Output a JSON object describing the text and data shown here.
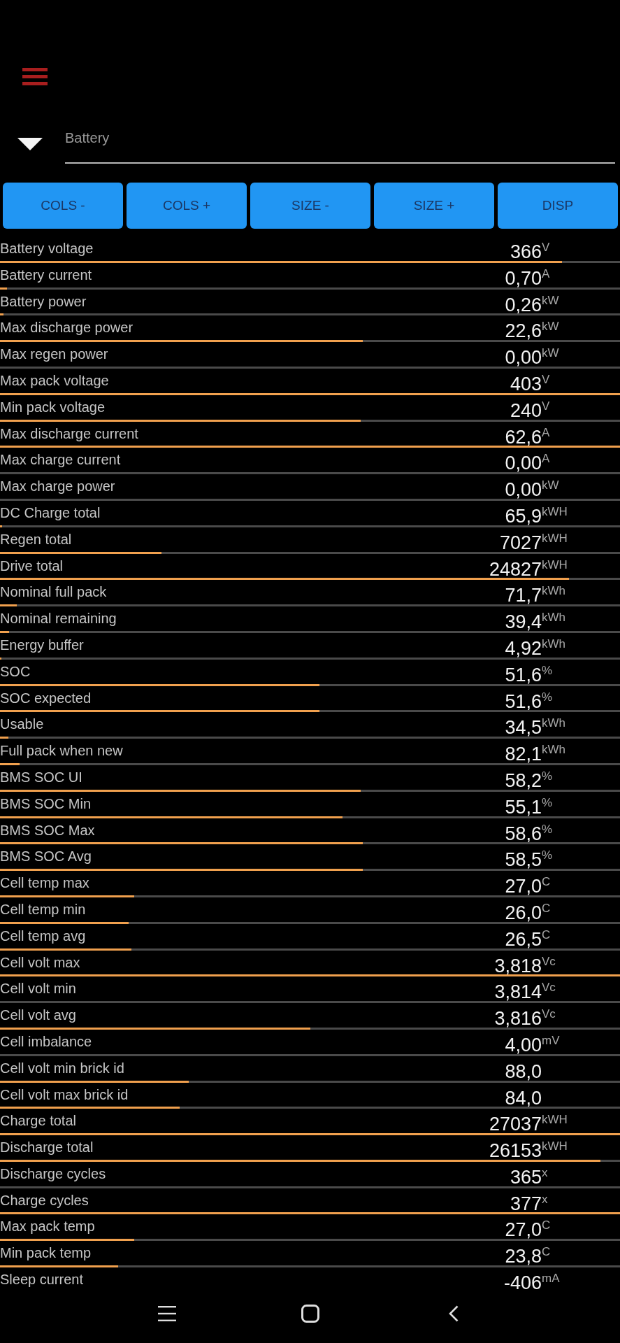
{
  "selector": {
    "value": "Battery"
  },
  "buttons": [
    "COLS -",
    "COLS +",
    "SIZE -",
    "SIZE +",
    "DISP"
  ],
  "readings": [
    {
      "name": "Battery voltage",
      "value": "366",
      "unit": "V",
      "level": 0.906
    },
    {
      "name": "Battery current",
      "value": "0,70",
      "unit": "A",
      "level": 0.011
    },
    {
      "name": "Battery power",
      "value": "0,26",
      "unit": "kW",
      "level": 0.006
    },
    {
      "name": "Max discharge power",
      "value": "22,6",
      "unit": "kW",
      "level": 0.585
    },
    {
      "name": "Max regen power",
      "value": "0,00",
      "unit": "kW",
      "level": 0
    },
    {
      "name": "Max pack voltage",
      "value": "403",
      "unit": "V",
      "level": 1
    },
    {
      "name": "Min pack voltage",
      "value": "240",
      "unit": "V",
      "level": 0.582
    },
    {
      "name": "Max discharge current",
      "value": "62,6",
      "unit": "A",
      "level": 1
    },
    {
      "name": "Max charge current",
      "value": "0,00",
      "unit": "A",
      "level": 0
    },
    {
      "name": "Max charge power",
      "value": "0,00",
      "unit": "kW",
      "level": 0
    },
    {
      "name": "DC Charge total",
      "value": "65,9",
      "unit": "kWH",
      "level": 0.003
    },
    {
      "name": "Regen total",
      "value": "7027",
      "unit": "kWH",
      "level": 0.26
    },
    {
      "name": "Drive total",
      "value": "24827",
      "unit": "kWH",
      "level": 0.918
    },
    {
      "name": "Nominal full pack",
      "value": "71,7",
      "unit": "kWh",
      "level": 0.027
    },
    {
      "name": "Nominal remaining",
      "value": "39,4",
      "unit": "kWh",
      "level": 0.015
    },
    {
      "name": "Energy buffer",
      "value": "4,92",
      "unit": "kWh",
      "level": 0.002
    },
    {
      "name": "SOC",
      "value": "51,6",
      "unit": "%",
      "level": 0.515
    },
    {
      "name": "SOC expected",
      "value": "51,6",
      "unit": "%",
      "level": 0.515
    },
    {
      "name": "Usable",
      "value": "34,5",
      "unit": "kWh",
      "level": 0.013
    },
    {
      "name": "Full pack when new",
      "value": "82,1",
      "unit": "kWh",
      "level": 0.032
    },
    {
      "name": "BMS SOC UI",
      "value": "58,2",
      "unit": "%",
      "level": 0.582
    },
    {
      "name": "BMS SOC Min",
      "value": "55,1",
      "unit": "%",
      "level": 0.552
    },
    {
      "name": "BMS SOC Max",
      "value": "58,6",
      "unit": "%",
      "level": 0.585
    },
    {
      "name": "BMS SOC Avg",
      "value": "58,5",
      "unit": "%",
      "level": 0.585
    },
    {
      "name": "Cell temp max",
      "value": "27,0",
      "unit": "C",
      "level": 0.217
    },
    {
      "name": "Cell temp min",
      "value": "26,0",
      "unit": "C",
      "level": 0.208
    },
    {
      "name": "Cell temp avg",
      "value": "26,5",
      "unit": "C",
      "level": 0.212
    },
    {
      "name": "Cell volt max",
      "value": "3,818",
      "unit": "Vc",
      "level": 1
    },
    {
      "name": "Cell volt min",
      "value": "3,814",
      "unit": "Vc",
      "level": 0
    },
    {
      "name": "Cell volt avg",
      "value": "3,816",
      "unit": "Vc",
      "level": 0.5
    },
    {
      "name": "Cell imbalance",
      "value": "4,00",
      "unit": "mV",
      "level": 0
    },
    {
      "name": "Cell volt min brick id",
      "value": "88,0",
      "level": 0.304
    },
    {
      "name": "Cell volt max brick id",
      "value": "84,0",
      "level": 0.29
    },
    {
      "name": "Charge total",
      "value": "27037",
      "unit": "kWH",
      "level": 1
    },
    {
      "name": "Discharge total",
      "value": "26153",
      "unit": "kWH",
      "level": 0.968
    },
    {
      "name": "Discharge cycles",
      "value": "365",
      "unit": "x",
      "level": 0
    },
    {
      "name": "Charge cycles",
      "value": "377",
      "unit": "x",
      "level": 1
    },
    {
      "name": "Max pack temp",
      "value": "27,0",
      "unit": "C",
      "level": 0.217
    },
    {
      "name": "Min pack temp",
      "value": "23,8",
      "unit": "C",
      "level": 0.19
    },
    {
      "name": "Sleep current",
      "value": "-406",
      "unit": "mA"
    }
  ]
}
